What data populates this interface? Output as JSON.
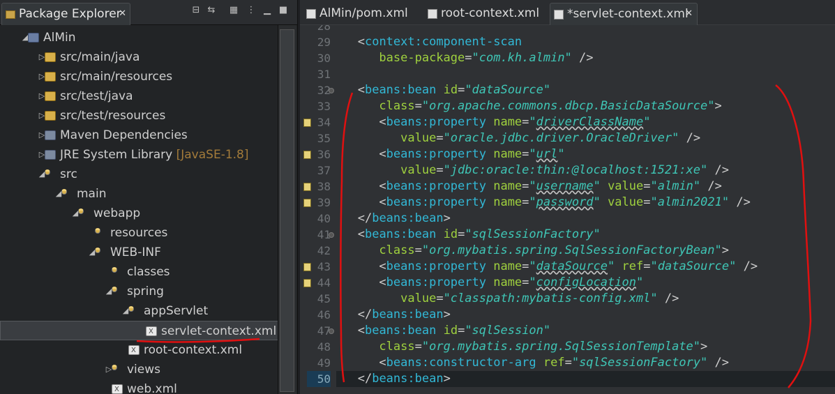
{
  "left_pane": {
    "view_title": "Package Explorer",
    "tree": [
      {
        "label": "AlMin",
        "suffix": "",
        "depth": 0,
        "icon": "project-icon",
        "twisty": "expanded"
      },
      {
        "label": "src/main/java",
        "suffix": "",
        "depth": 1,
        "icon": "package-folder-icon",
        "twisty": "collapsed"
      },
      {
        "label": "src/main/resources",
        "suffix": "",
        "depth": 1,
        "icon": "package-folder-icon",
        "twisty": "collapsed"
      },
      {
        "label": "src/test/java",
        "suffix": "",
        "depth": 1,
        "icon": "package-folder-icon",
        "twisty": "collapsed"
      },
      {
        "label": "src/test/resources",
        "suffix": "",
        "depth": 1,
        "icon": "package-folder-icon",
        "twisty": "collapsed"
      },
      {
        "label": "Maven Dependencies",
        "suffix": "",
        "depth": 1,
        "icon": "library-icon",
        "twisty": "collapsed"
      },
      {
        "label": "JRE System Library",
        "suffix": "[JavaSE-1.8]",
        "depth": 1,
        "icon": "library-icon",
        "twisty": "collapsed"
      },
      {
        "label": "src",
        "suffix": "",
        "depth": 1,
        "icon": "folder-icon",
        "twisty": "expanded"
      },
      {
        "label": "main",
        "suffix": "",
        "depth": 2,
        "icon": "folder-icon",
        "twisty": "expanded"
      },
      {
        "label": "webapp",
        "suffix": "",
        "depth": 3,
        "icon": "folder-icon",
        "twisty": "expanded"
      },
      {
        "label": "resources",
        "suffix": "",
        "depth": 4,
        "icon": "folder-icon",
        "twisty": "none"
      },
      {
        "label": "WEB-INF",
        "suffix": "",
        "depth": 4,
        "icon": "folder-icon",
        "twisty": "expanded"
      },
      {
        "label": "classes",
        "suffix": "",
        "depth": 5,
        "icon": "folder-icon",
        "twisty": "none"
      },
      {
        "label": "spring",
        "suffix": "",
        "depth": 5,
        "icon": "folder-icon",
        "twisty": "expanded"
      },
      {
        "label": "appServlet",
        "suffix": "",
        "depth": 6,
        "icon": "folder-icon",
        "twisty": "expanded"
      },
      {
        "label": "servlet-context.xml",
        "suffix": "",
        "depth": 7,
        "icon": "xml-file-icon",
        "twisty": "none",
        "selected": true
      },
      {
        "label": "root-context.xml",
        "suffix": "",
        "depth": 6,
        "icon": "xml-file-icon",
        "twisty": "none"
      },
      {
        "label": "views",
        "suffix": "",
        "depth": 5,
        "icon": "folder-icon",
        "twisty": "collapsed"
      },
      {
        "label": "web.xml",
        "suffix": "",
        "depth": 5,
        "icon": "xml-file-icon",
        "twisty": "none"
      }
    ]
  },
  "editor": {
    "tabs": [
      {
        "label": "AlMin/pom.xml",
        "active": false
      },
      {
        "label": "root-context.xml",
        "active": false
      },
      {
        "label": "*servlet-context.xml",
        "active": true
      }
    ],
    "lines": [
      {
        "n": "28",
        "text": ""
      },
      {
        "n": "29",
        "text": "   <context:component-scan"
      },
      {
        "n": "30",
        "text": "      base-package=\"com.kh.almin\" />"
      },
      {
        "n": "31",
        "text": ""
      },
      {
        "n": "32",
        "text": "   <beans:bean id=\"dataSource\"",
        "fold": true
      },
      {
        "n": "33",
        "text": "      class=\"org.apache.commons.dbcp.BasicDataSource\">"
      },
      {
        "n": "34",
        "text": "      <beans:property name=\"driverClassName\"",
        "mark": true
      },
      {
        "n": "35",
        "text": "         value=\"oracle.jdbc.driver.OracleDriver\" />"
      },
      {
        "n": "36",
        "text": "      <beans:property name=\"url\"",
        "mark": true
      },
      {
        "n": "37",
        "text": "         value=\"jdbc:oracle:thin:@localhost:1521:xe\" />"
      },
      {
        "n": "38",
        "text": "      <beans:property name=\"username\" value=\"almin\" />",
        "mark": true
      },
      {
        "n": "39",
        "text": "      <beans:property name=\"password\" value=\"almin2021\" />",
        "mark": true
      },
      {
        "n": "40",
        "text": "   </beans:bean>"
      },
      {
        "n": "41",
        "text": "   <beans:bean id=\"sqlSessionFactory\"",
        "fold": true
      },
      {
        "n": "42",
        "text": "      class=\"org.mybatis.spring.SqlSessionFactoryBean\">"
      },
      {
        "n": "43",
        "text": "      <beans:property name=\"dataSource\" ref=\"dataSource\" />",
        "mark": true
      },
      {
        "n": "44",
        "text": "      <beans:property name=\"configLocation\"",
        "mark": true
      },
      {
        "n": "45",
        "text": "         value=\"classpath:mybatis-config.xml\" />"
      },
      {
        "n": "46",
        "text": "   </beans:bean>"
      },
      {
        "n": "47",
        "text": "   <beans:bean id=\"sqlSession\"",
        "fold": true
      },
      {
        "n": "48",
        "text": "      class=\"org.mybatis.spring.SqlSessionTemplate\">"
      },
      {
        "n": "49",
        "text": "      <beans:constructor-arg ref=\"sqlSessionFactory\" />"
      },
      {
        "n": "50",
        "text": "   </beans:bean>",
        "current": true
      }
    ]
  },
  "colors": {
    "tag": "#32b8d6",
    "attr": "#9fd13e",
    "value": "#3fc6b6",
    "annotation": "#e01010"
  }
}
